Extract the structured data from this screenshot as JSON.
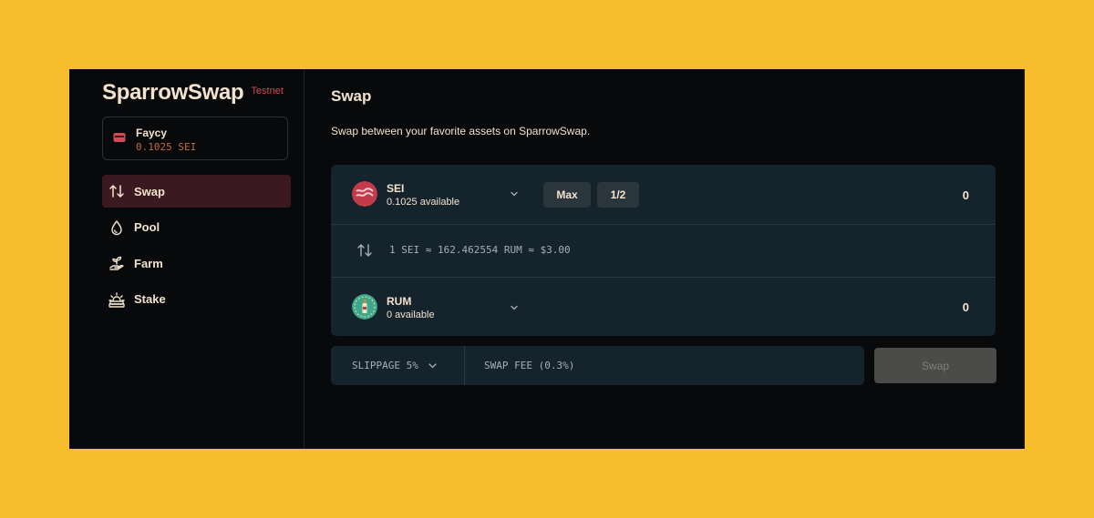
{
  "brand": {
    "name": "SparrowSwap",
    "tag": "Testnet"
  },
  "wallet": {
    "name": "Faycy",
    "balance": "0.1025 SEI",
    "icon": "wallet-icon"
  },
  "nav": [
    {
      "label": "Swap",
      "icon": "swap-arrows-icon",
      "active": true
    },
    {
      "label": "Pool",
      "icon": "drop-icon",
      "active": false
    },
    {
      "label": "Farm",
      "icon": "sprout-hand-icon",
      "active": false
    },
    {
      "label": "Stake",
      "icon": "sunrise-icon",
      "active": false
    }
  ],
  "page": {
    "title": "Swap",
    "subtitle": "Swap between your favorite assets on SparrowSwap."
  },
  "from": {
    "token": "SEI",
    "available": "0.1025 available",
    "max_label": "Max",
    "half_label": "1/2",
    "amount": "0"
  },
  "rate": {
    "text": "1 SEI ≈ 162.462554 RUM ≈ $3.00"
  },
  "to": {
    "token": "RUM",
    "available": "0 available",
    "amount": "0"
  },
  "settings": {
    "slippage": "SLIPPAGE 5%",
    "fee": "SWAP FEE (0.3%)"
  },
  "swap_button": "Swap",
  "colors": {
    "background": "#f8bd2c",
    "panel": "#07090b",
    "card": "#15232c",
    "accent": "#3a1a20",
    "text": "#f3e2cc",
    "tag": "#d24a56"
  }
}
